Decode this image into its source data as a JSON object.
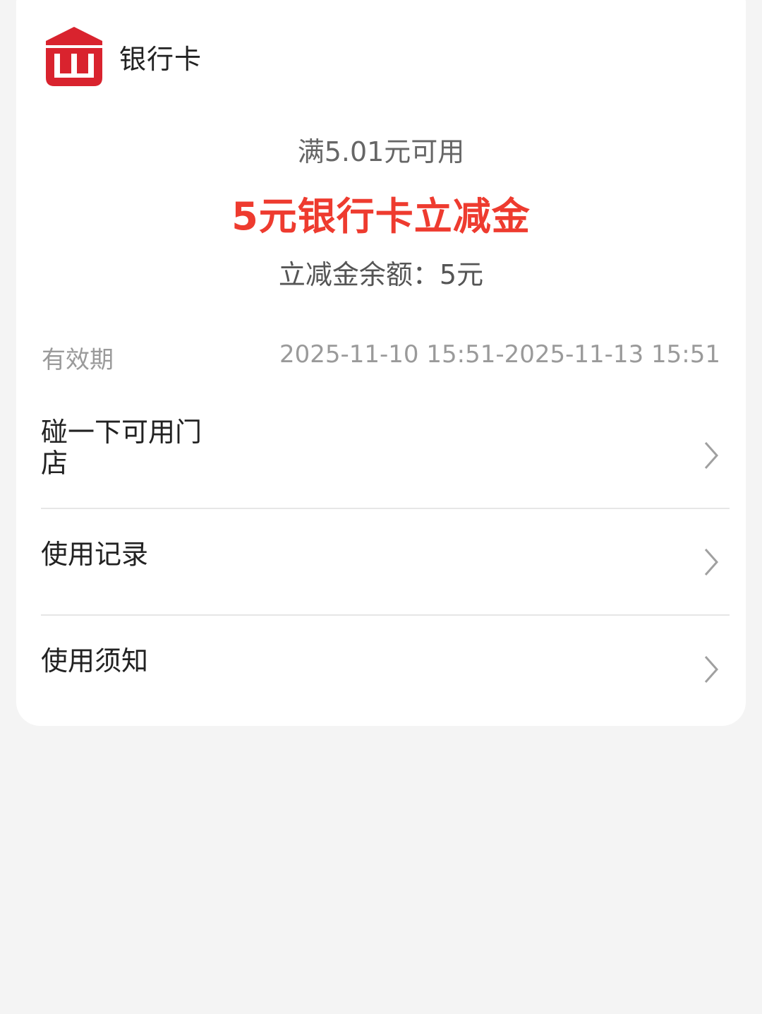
{
  "header": {
    "logo_icon": "bank-building-icon",
    "title": "银行卡",
    "brand_color": "#d9232e"
  },
  "voucher": {
    "threshold": "满5.01元可用",
    "title": "5元银行卡立减金",
    "balance": "立减金余额：5元",
    "accent_color": "#ee3b2f"
  },
  "validity": {
    "label": "有效期",
    "value": "2025-11-10 15:51-2025-11-13 15:51"
  },
  "menu": [
    {
      "label": "碰一下可用门店",
      "icon": "chevron-right-icon"
    },
    {
      "label": "使用记录",
      "icon": "chevron-right-icon"
    },
    {
      "label": "使用须知",
      "icon": "chevron-right-icon"
    }
  ]
}
